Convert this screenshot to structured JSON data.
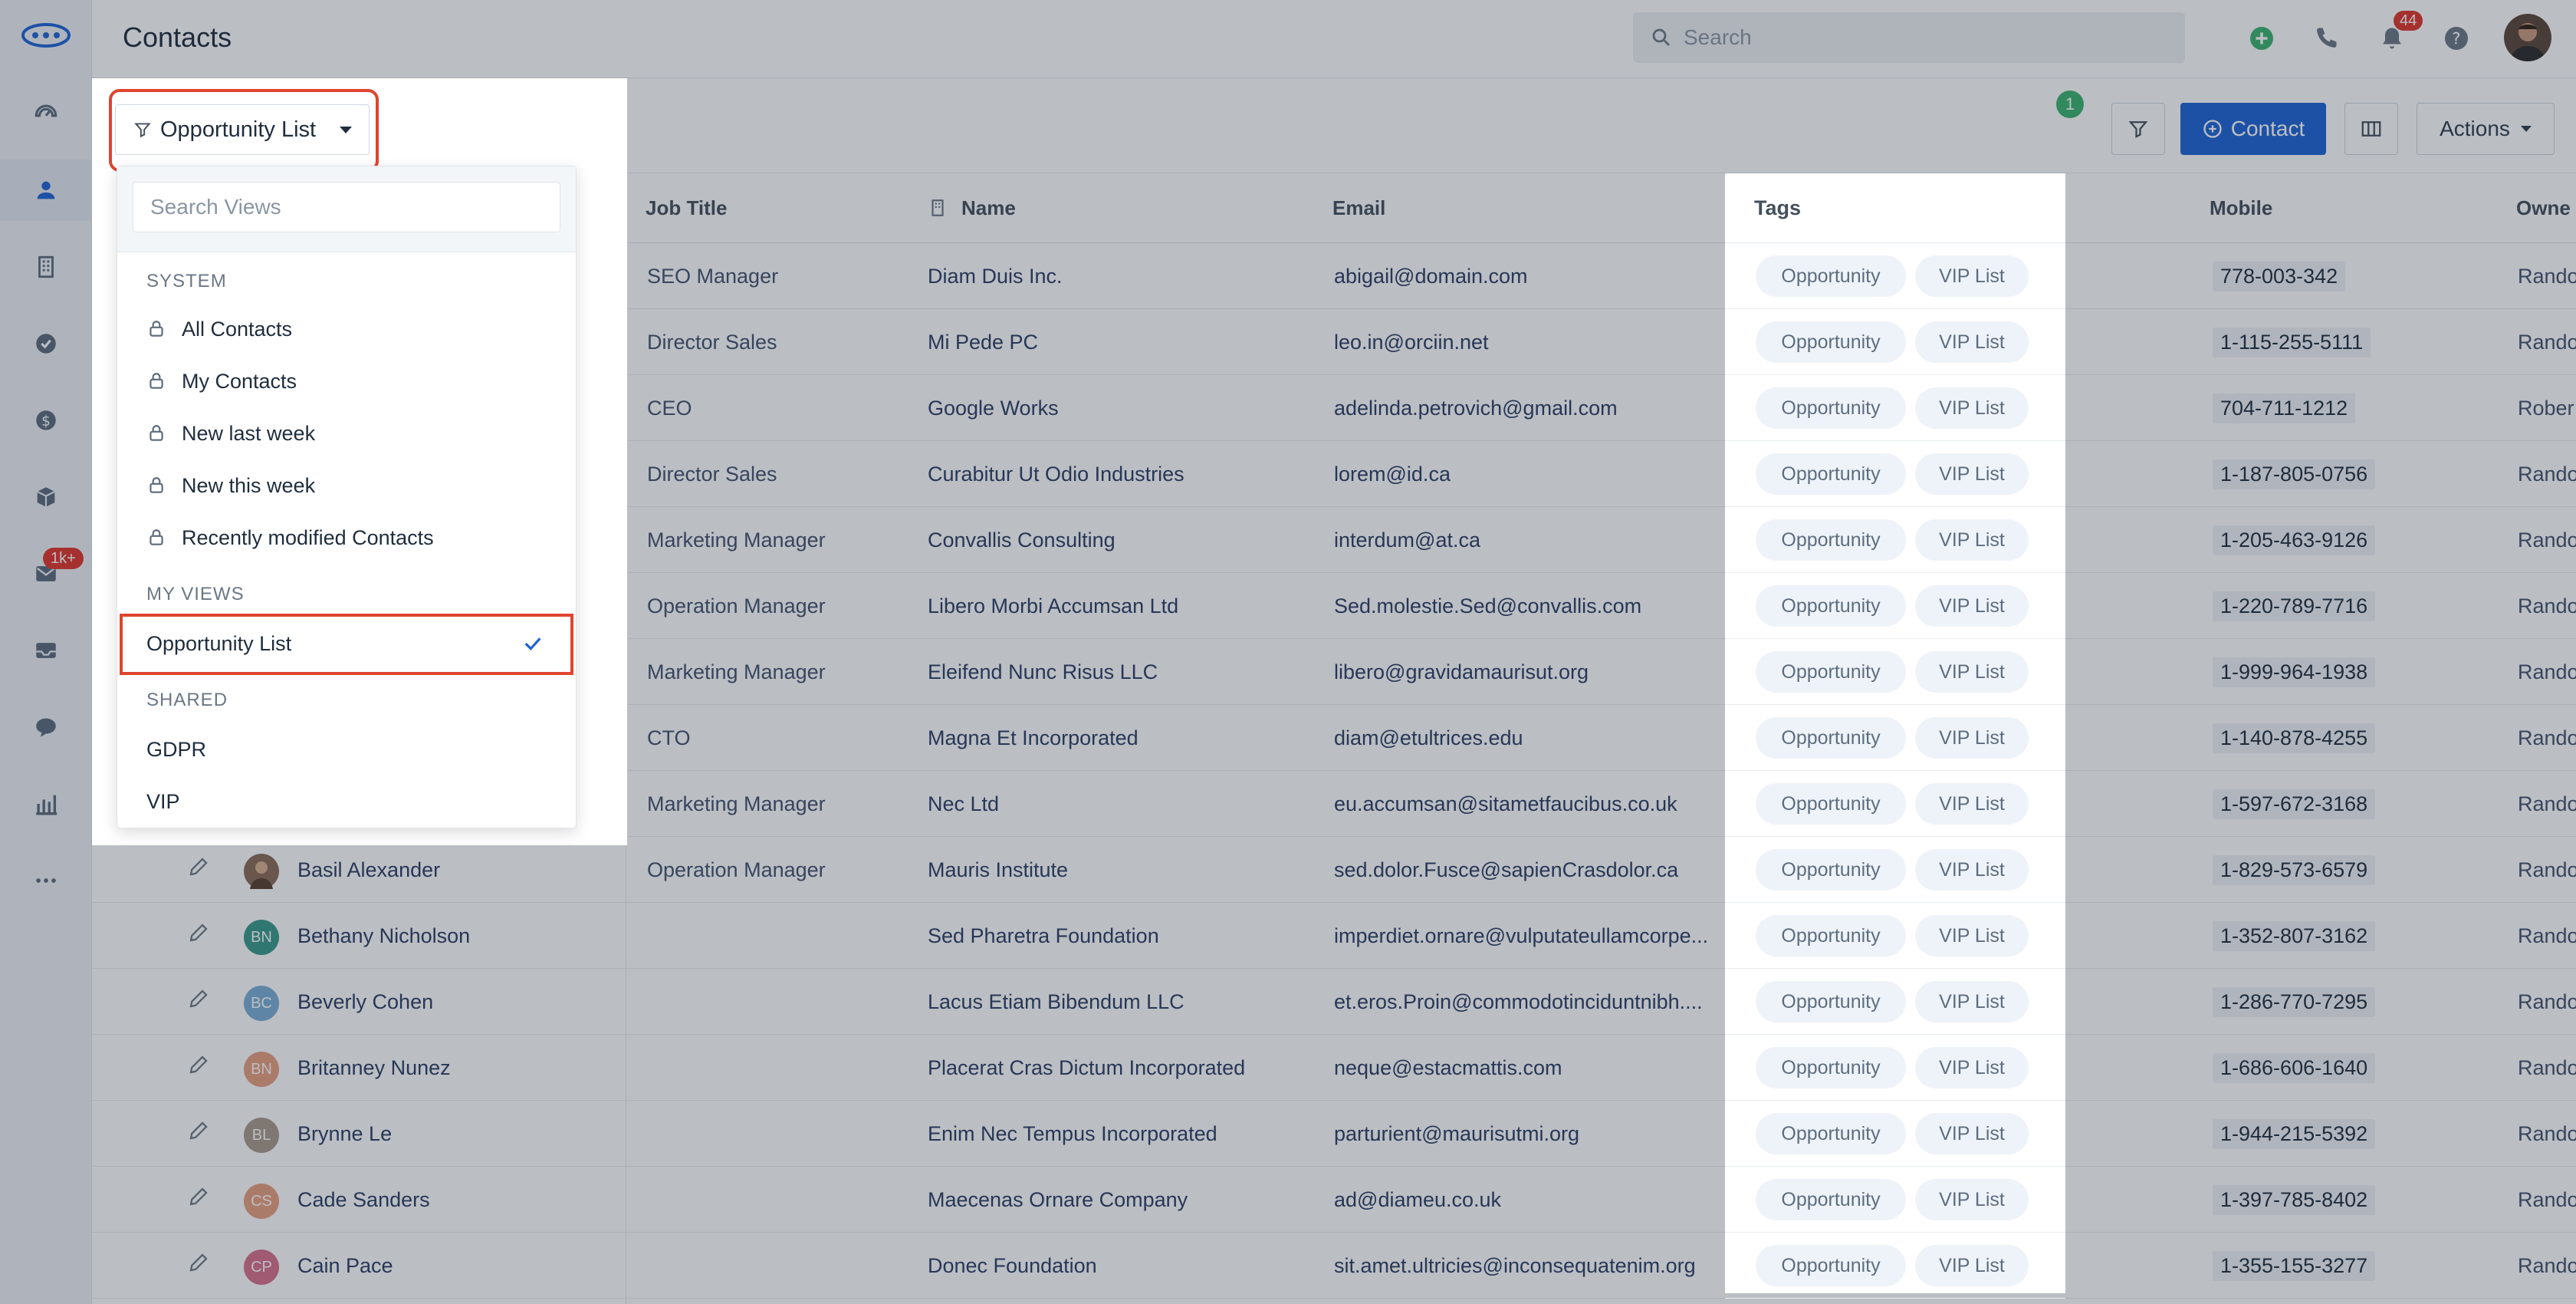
{
  "nav": {
    "items": [
      {
        "name": "dashboard-icon"
      },
      {
        "name": "contacts-icon"
      },
      {
        "name": "companies-icon"
      },
      {
        "name": "tasks-icon"
      },
      {
        "name": "deals-icon"
      },
      {
        "name": "products-icon"
      },
      {
        "name": "mail-icon"
      },
      {
        "name": "inbox-icon"
      },
      {
        "name": "chat-icon"
      },
      {
        "name": "reports-icon"
      },
      {
        "name": "more-icon"
      }
    ],
    "mail_badge": "1k+"
  },
  "header": {
    "title": "Contacts",
    "search_placeholder": "Search",
    "notif_badge": "44"
  },
  "toolbar": {
    "filter_badge": "1",
    "add_contact_label": "Contact",
    "actions_label": "Actions"
  },
  "view_selector": {
    "current": "Opportunity List",
    "search_placeholder": "Search Views",
    "sections": {
      "system": "SYSTEM",
      "my_views": "MY VIEWS",
      "shared": "SHARED"
    },
    "system_views": [
      "All Contacts",
      "My Contacts",
      "New last week",
      "New this week",
      "Recently modified Contacts"
    ],
    "my_views": [
      "Opportunity List"
    ],
    "shared_views": [
      "GDPR",
      "VIP"
    ]
  },
  "table": {
    "headers": {
      "job_title": "Job Title",
      "name": "Name",
      "email": "Email",
      "tags": "Tags",
      "mobile": "Mobile",
      "owner": "Owne"
    },
    "rows": [
      {
        "initials": "",
        "contact": "",
        "job": "SEO Manager",
        "company": "Diam Duis Inc.",
        "email": "abigail@domain.com",
        "tags": [
          "Opportunity",
          "VIP List"
        ],
        "mobile": "778-003-342",
        "owner": "Rando"
      },
      {
        "initials": "",
        "contact": "",
        "job": "Director Sales",
        "company": "Mi Pede PC",
        "email": "leo.in@orciin.net",
        "tags": [
          "Opportunity",
          "VIP List"
        ],
        "mobile": "1-115-255-5111",
        "owner": "Rando"
      },
      {
        "initials": "",
        "contact": "",
        "job": "CEO",
        "company": "Google Works",
        "email": "adelinda.petrovich@gmail.com",
        "tags": [
          "Opportunity",
          "VIP List"
        ],
        "mobile": "704-711-1212",
        "owner": "Rober"
      },
      {
        "initials": "",
        "contact": "",
        "job": "Director Sales",
        "company": "Curabitur Ut Odio Industries",
        "email": "lorem@id.ca",
        "tags": [
          "Opportunity",
          "VIP List"
        ],
        "mobile": "1-187-805-0756",
        "owner": "Rando"
      },
      {
        "initials": "",
        "contact": "",
        "job": "Marketing Manager",
        "company": "Convallis Consulting",
        "email": "interdum@at.ca",
        "tags": [
          "Opportunity",
          "VIP List"
        ],
        "mobile": "1-205-463-9126",
        "owner": "Rando"
      },
      {
        "initials": "",
        "contact": "",
        "job": "Operation Manager",
        "company": "Libero Morbi Accumsan Ltd",
        "email": "Sed.molestie.Sed@convallis.com",
        "tags": [
          "Opportunity",
          "VIP List"
        ],
        "mobile": "1-220-789-7716",
        "owner": "Rando"
      },
      {
        "initials": "",
        "contact": "",
        "job": "Marketing Manager",
        "company": "Eleifend Nunc Risus LLC",
        "email": "libero@gravidamaurisut.org",
        "tags": [
          "Opportunity",
          "VIP List"
        ],
        "mobile": "1-999-964-1938",
        "owner": "Rando"
      },
      {
        "initials": "",
        "contact": "",
        "job": "CTO",
        "company": "Magna Et Incorporated",
        "email": "diam@etultrices.edu",
        "tags": [
          "Opportunity",
          "VIP List"
        ],
        "mobile": "1-140-878-4255",
        "owner": "Rando"
      },
      {
        "initials": "",
        "contact": "",
        "job": "Marketing Manager",
        "company": "Nec Ltd",
        "email": "eu.accumsan@sitametfaucibus.co.uk",
        "tags": [
          "Opportunity",
          "VIP List"
        ],
        "mobile": "1-597-672-3168",
        "owner": "Rando"
      },
      {
        "initials": "",
        "contact": "Basil Alexander",
        "job": "Operation Manager",
        "company": "Mauris Institute",
        "email": "sed.dolor.Fusce@sapienCrasdolor.ca",
        "tags": [
          "Opportunity",
          "VIP List"
        ],
        "mobile": "1-829-573-6579",
        "owner": "Rando"
      },
      {
        "initials": "BN",
        "contact": "Bethany Nicholson",
        "job": "",
        "company": "Sed Pharetra Foundation",
        "email": "imperdiet.ornare@vulputateullamcorpe...",
        "tags": [
          "Opportunity",
          "VIP List"
        ],
        "mobile": "1-352-807-3162",
        "owner": "Rando"
      },
      {
        "initials": "BC",
        "contact": "Beverly Cohen",
        "job": "",
        "company": "Lacus Etiam Bibendum LLC",
        "email": "et.eros.Proin@commodotinciduntnibh....",
        "tags": [
          "Opportunity",
          "VIP List"
        ],
        "mobile": "1-286-770-7295",
        "owner": "Rando"
      },
      {
        "initials": "BN",
        "contact": "Britanney Nunez",
        "job": "",
        "company": "Placerat Cras Dictum Incorporated",
        "more": "...",
        "email": "neque@estacmattis.com",
        "tags": [
          "Opportunity",
          "VIP List"
        ],
        "mobile": "1-686-606-1640",
        "owner": "Rando"
      },
      {
        "initials": "BL",
        "contact": "Brynne Le",
        "job": "",
        "company": "Enim Nec Tempus Incorporated",
        "more": "...",
        "email": "parturient@maurisutmi.org",
        "tags": [
          "Opportunity",
          "VIP List"
        ],
        "mobile": "1-944-215-5392",
        "owner": "Rando"
      },
      {
        "initials": "CS",
        "contact": "Cade Sanders",
        "job": "",
        "company": "Maecenas Ornare Company",
        "email": "ad@diameu.co.uk",
        "tags": [
          "Opportunity",
          "VIP List"
        ],
        "mobile": "1-397-785-8402",
        "owner": "Rando"
      },
      {
        "initials": "CP",
        "contact": "Cain Pace",
        "job": "",
        "company": "Donec Foundation",
        "email": "sit.amet.ultricies@inconsequatenim.org",
        "tags": [
          "Opportunity",
          "VIP List"
        ],
        "mobile": "1-355-155-3277",
        "owner": "Rando"
      }
    ]
  },
  "colors": {
    "accent": "#1e63d6",
    "highlight_ring": "#e0442f",
    "badge_red": "#e0352b",
    "badge_green": "#3bb36e",
    "avatar_colors": [
      "#e8a07e",
      "#a89a8c",
      "#e8a07e",
      "#d9708a",
      "#3a9a8a",
      "#7aaed6"
    ]
  }
}
